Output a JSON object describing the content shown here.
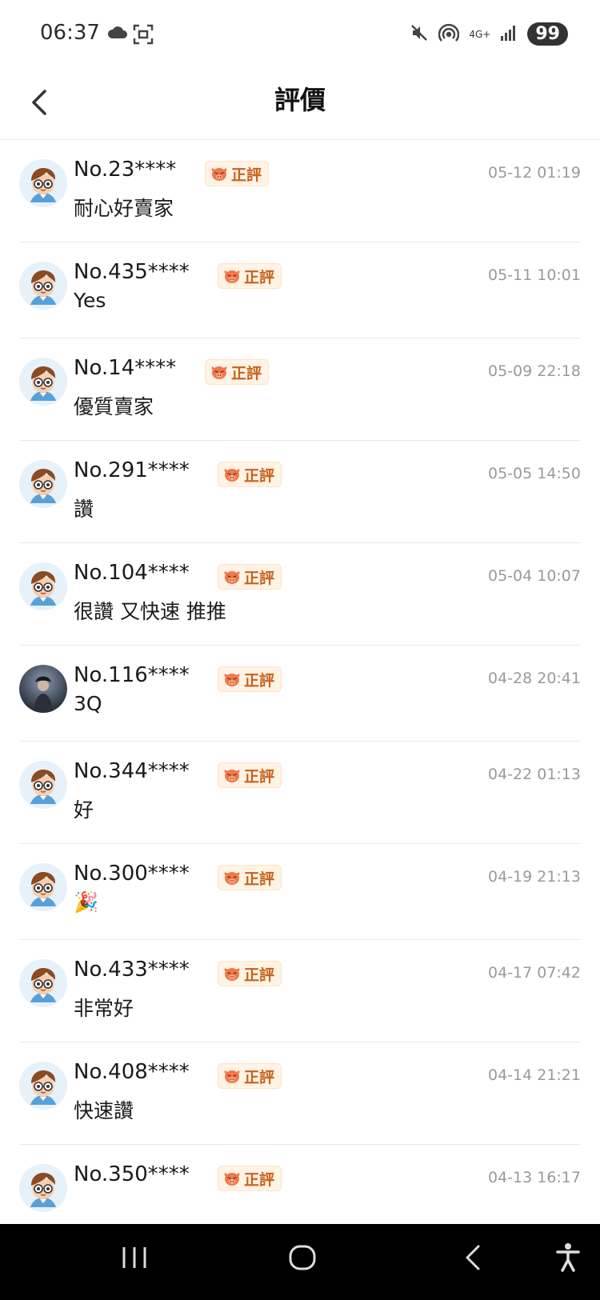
{
  "status_bar": {
    "time": "06:37",
    "network": "4G+",
    "battery": "99"
  },
  "header": {
    "title": "評價"
  },
  "badge_label": "正評",
  "reviews": [
    {
      "user": "No.23****",
      "time": "05-12 01:19",
      "comment": "耐心好賣家",
      "avatar": "cartoon"
    },
    {
      "user": "No.435****",
      "time": "05-11 10:01",
      "comment": "Yes",
      "avatar": "cartoon"
    },
    {
      "user": "No.14****",
      "time": "05-09 22:18",
      "comment": "優質賣家",
      "avatar": "cartoon"
    },
    {
      "user": "No.291****",
      "time": "05-05 14:50",
      "comment": "讚",
      "avatar": "cartoon"
    },
    {
      "user": "No.104****",
      "time": "05-04 10:07",
      "comment": "很讚 又快速 推推",
      "avatar": "cartoon"
    },
    {
      "user": "No.116****",
      "time": "04-28 20:41",
      "comment": "3Q",
      "avatar": "photo"
    },
    {
      "user": "No.344****",
      "time": "04-22 01:13",
      "comment": "好",
      "avatar": "cartoon"
    },
    {
      "user": "No.300****",
      "time": "04-19 21:13",
      "comment": "🎉",
      "avatar": "cartoon"
    },
    {
      "user": "No.433****",
      "time": "04-17 07:42",
      "comment": "非常好",
      "avatar": "cartoon"
    },
    {
      "user": "No.408****",
      "time": "04-14 21:21",
      "comment": "快速讚",
      "avatar": "cartoon"
    },
    {
      "user": "No.350****",
      "time": "04-13 16:17",
      "comment": "",
      "avatar": "cartoon"
    }
  ],
  "colors": {
    "badge_text": "#c8621a",
    "badge_bg": "#fff3e6",
    "timestamp": "#9a9a9a"
  }
}
